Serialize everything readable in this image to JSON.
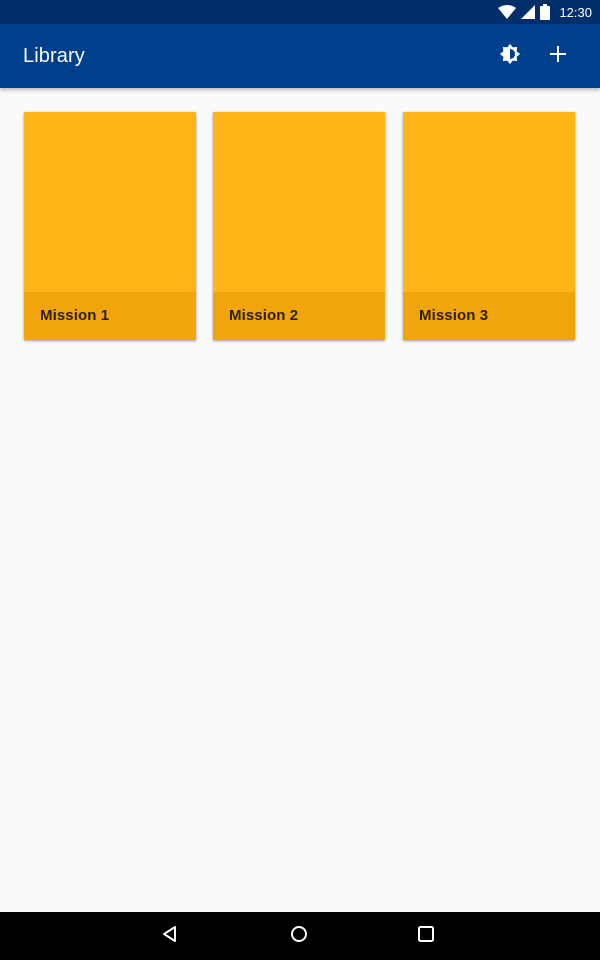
{
  "status_bar": {
    "time": "12:30",
    "icons": [
      "wifi-icon",
      "cellular-signal-icon",
      "battery-icon"
    ]
  },
  "app_bar": {
    "title": "Library",
    "actions": [
      {
        "icon": "brightness-icon"
      },
      {
        "icon": "add-icon"
      }
    ],
    "background": "#003f8c",
    "status_background": "#002e6a"
  },
  "library": {
    "items": [
      {
        "title": "Mission 1"
      },
      {
        "title": "Mission 2"
      },
      {
        "title": "Mission 3"
      }
    ],
    "card_color": "#fdb518",
    "card_footer_color": "#f1a50c"
  },
  "navigation_bar": {
    "buttons": [
      {
        "icon": "back-triangle-icon"
      },
      {
        "icon": "home-circle-icon"
      },
      {
        "icon": "recents-square-icon"
      }
    ]
  }
}
